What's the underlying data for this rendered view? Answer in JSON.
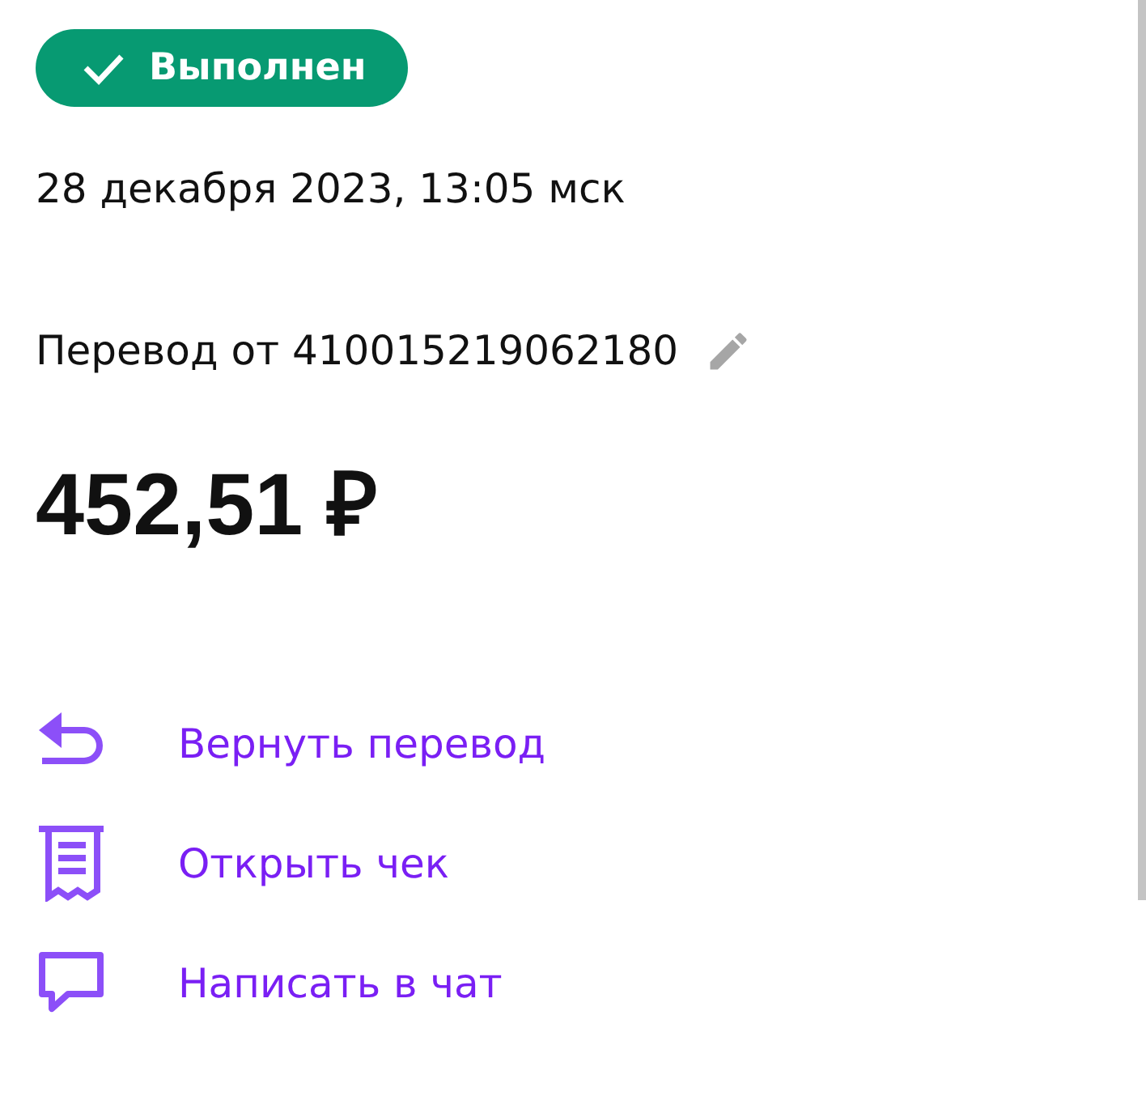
{
  "status": {
    "label": "Выполнен",
    "kind": "done"
  },
  "date": "28 декабря 2023, 13:05 мск",
  "transfer": {
    "label": "Перевод от 410015219062180"
  },
  "amount": "452,51 ₽",
  "actions": [
    {
      "kind": "return",
      "label": "Вернуть перевод"
    },
    {
      "kind": "receipt",
      "label": "Открыть чек"
    },
    {
      "kind": "chat",
      "label": "Написать в чат"
    }
  ]
}
